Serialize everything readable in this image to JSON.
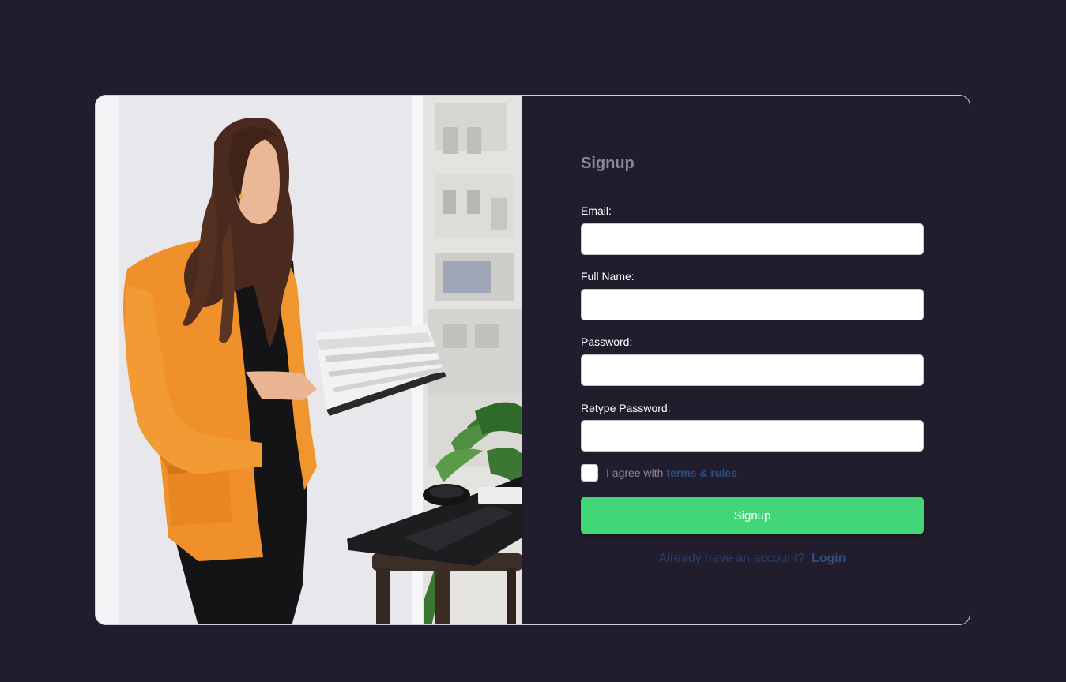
{
  "photo": {
    "alt": "Woman in orange blazer reading a book beside a laptop"
  },
  "form": {
    "title": "Signup",
    "fields": [
      {
        "label": "Email:",
        "value": "",
        "placeholder": ""
      },
      {
        "label": "Full Name:",
        "value": "",
        "placeholder": ""
      },
      {
        "label": "Password:",
        "value": "",
        "placeholder": ""
      },
      {
        "label": "Retype Password:",
        "value": "",
        "placeholder": ""
      }
    ],
    "agree": {
      "text": "I agree with",
      "link": "terms & rules",
      "checked": false
    },
    "submit_label": "Signup",
    "login_prompt": "Already have an account?",
    "login_link": "Login"
  },
  "colors": {
    "background": "#211d2d",
    "accent_green": "#41d677",
    "link_blue": "#2d4d85",
    "muted_text": "#8b8898"
  }
}
